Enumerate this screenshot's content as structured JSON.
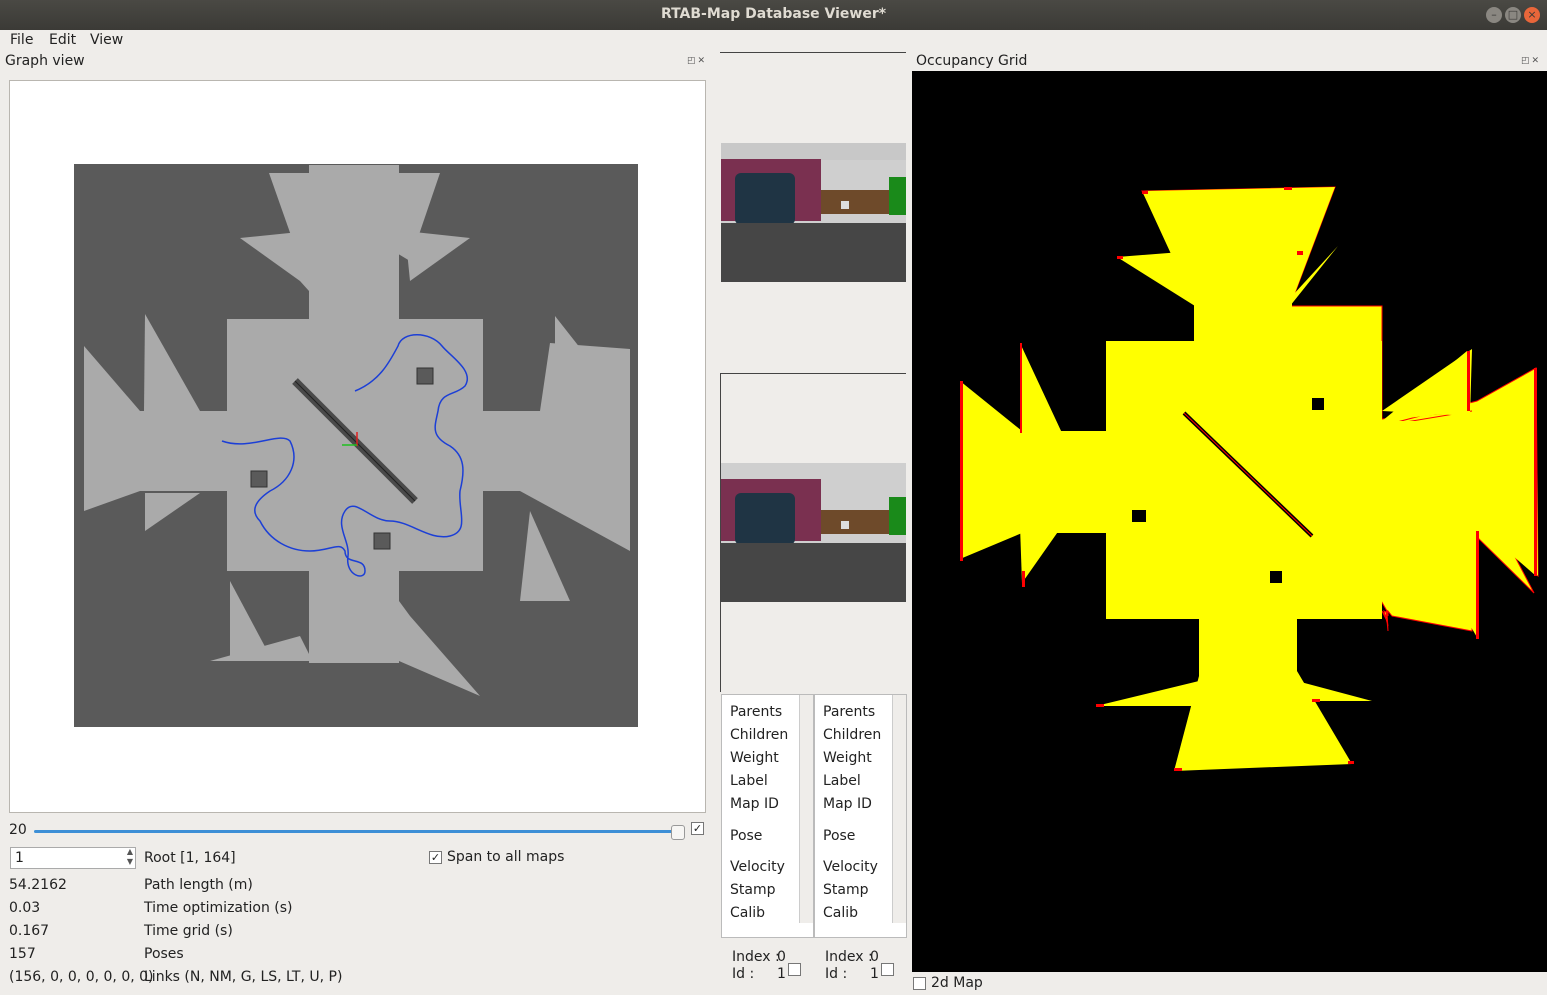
{
  "window": {
    "title": "RTAB-Map Database Viewer*"
  },
  "menu": [
    "File",
    "Edit",
    "View"
  ],
  "graph_view": {
    "title": "Graph view",
    "slider_value": "20",
    "root_value": "1",
    "root_label": "Root [1, 164]",
    "span_label": "Span to all maps",
    "stats": [
      {
        "value": "54.2162",
        "label": "Path length (m)"
      },
      {
        "value": "0.03",
        "label": "Time optimization (s)"
      },
      {
        "value": "0.167",
        "label": "Time grid (s)"
      },
      {
        "value": "157",
        "label": "Poses"
      },
      {
        "value": "(156, 0, 0, 0, 0, 0, 0)",
        "label": "Links (N, NM, G, LS, LT, U, P)"
      }
    ]
  },
  "info_left": {
    "rows": [
      "Parents",
      "Children",
      "Weight",
      "Label",
      "Map ID",
      "Pose",
      "Velocity",
      "Stamp",
      "Calib"
    ],
    "index_label": "Index :",
    "index_value": "0",
    "id_label": "Id :",
    "id_value": "1"
  },
  "info_right": {
    "rows": [
      "Parents",
      "Children",
      "Weight",
      "Label",
      "Map ID",
      "Pose",
      "Velocity",
      "Stamp",
      "Calib"
    ],
    "index_label": "Index :",
    "index_value": "0",
    "id_label": "Id :",
    "id_value": "1"
  },
  "occupancy": {
    "title": "Occupancy Grid",
    "checkbox_label": "2d Map"
  },
  "colors": {
    "free": "#ffff00",
    "obstacle": "#ff0000",
    "unknown": "#000000",
    "path": "#0000ff"
  }
}
